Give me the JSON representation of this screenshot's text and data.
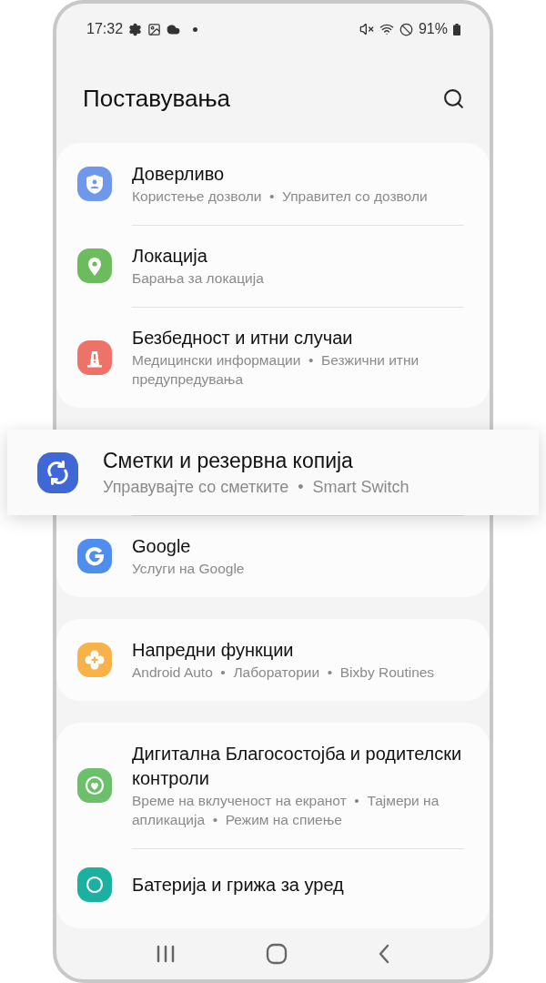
{
  "status_bar": {
    "time": "17:32",
    "battery": "91%"
  },
  "header": {
    "title": "Поставувања"
  },
  "groups": [
    {
      "items": [
        {
          "title": "Доверливо",
          "subtitle": "Користење дозволи  •  Управител со дозволи",
          "color": "#6f97eb",
          "highlighted": false
        },
        {
          "title": "Локација",
          "subtitle": "Барања за локација",
          "color": "#6cbb5f",
          "highlighted": false
        },
        {
          "title": "Безбедност и итни случаи",
          "subtitle": "Медицински информации  •  Безжични итни предупредувања",
          "color": "#ee7267",
          "highlighted": false
        }
      ]
    },
    {
      "items": [
        {
          "title": "Сметки и резервна копија",
          "subtitle": "Управувајте со сметките  •  Smart Switch",
          "color": "#3f68d6",
          "highlighted": true
        },
        {
          "title": "Google",
          "subtitle": "Услуги на Google",
          "color": "#4f8def",
          "highlighted": false
        }
      ]
    },
    {
      "items": [
        {
          "title": "Напредни функции",
          "subtitle": "Android Auto  •  Лаборатории  •  Bixby Routines",
          "color": "#f8b24a",
          "highlighted": false
        }
      ]
    },
    {
      "items": [
        {
          "title": "Дигитална Благосостојба и родителски контроли",
          "subtitle": "Време на вклученост на екранот  •  Тајмери на апликација  •  Режим на спиење",
          "color": "#6cbf6b",
          "highlighted": false
        },
        {
          "title": "Батерија и грижа за уред",
          "color": "#1bb0a0",
          "highlighted": false
        }
      ]
    }
  ]
}
